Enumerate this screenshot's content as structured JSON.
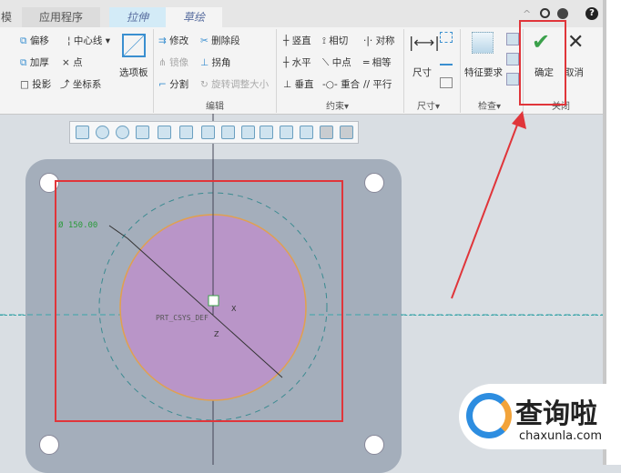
{
  "tabs": [
    {
      "label": "模"
    },
    {
      "label": "应用程序"
    },
    {
      "label": "拉伸"
    },
    {
      "label": "草绘"
    }
  ],
  "top_icons": {
    "collapse": "^",
    "search": "search-icon",
    "help": "?"
  },
  "sketch": {
    "offset": "偏移",
    "centerline": "中心线",
    "thicken": "加厚",
    "point": "点",
    "project": "投影",
    "csys": "坐标系",
    "palette": "选项板"
  },
  "edit": {
    "modify": "修改",
    "delete_segment": "删除段",
    "mirror": "镜像",
    "corner": "拐角",
    "divide": "分割",
    "rotate_resize": "旋转调整大小",
    "group": "编辑"
  },
  "constrain": {
    "vertical": "竖直",
    "tangent": "相切",
    "symmetric": "对称",
    "horizontal": "水平",
    "midpoint": "中点",
    "equal": "相等",
    "perpendicular": "垂直",
    "coincident": "重合",
    "parallel": "平行",
    "group": "约束▾"
  },
  "dimension": {
    "label": "尺寸",
    "group": "尺寸▾"
  },
  "inspect": {
    "feature_req": "特征要求",
    "group": "检查▾"
  },
  "close": {
    "ok": "确定",
    "cancel": "取消",
    "group": "关闭"
  },
  "canvas": {
    "dimension": "Ø 150.00",
    "csys": "PRT_CSYS_DEF",
    "x_axis": "X",
    "z_axis": "Z"
  },
  "watermark": {
    "name": "查询啦",
    "url": "chaxunla.com"
  },
  "colors": {
    "accent_red": "#e0353a",
    "check_green": "#3aa04a",
    "circle_fill": "#b995c8"
  }
}
